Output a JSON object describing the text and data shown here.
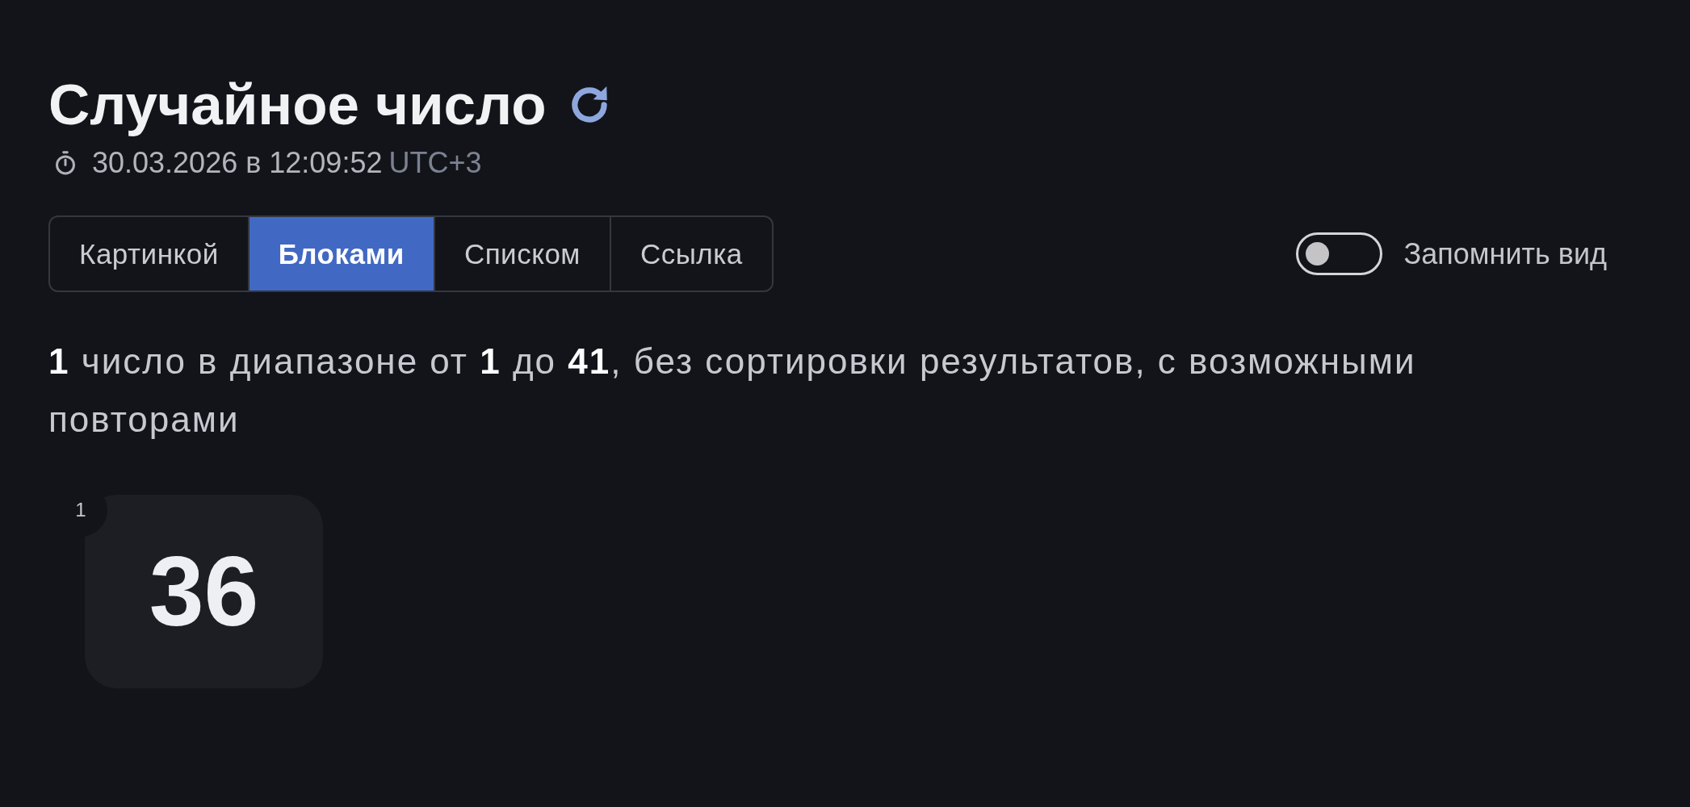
{
  "header": {
    "title": "Случайное число",
    "timestamp": "30.03.2026 в 12:09:52",
    "timezone": "UTC+3"
  },
  "view_tabs": [
    {
      "label": "Картинкой",
      "selected": false
    },
    {
      "label": "Блоками",
      "selected": true
    },
    {
      "label": "Списком",
      "selected": false
    },
    {
      "label": "Ссылка",
      "selected": false
    }
  ],
  "remember_view": {
    "label": "Запомнить вид",
    "on": false
  },
  "description": "**1** число в диапазоне от **1** до **41**, без сортировки результатов, с возможными повторами",
  "results": [
    {
      "index": "1",
      "value": "36"
    }
  ]
}
